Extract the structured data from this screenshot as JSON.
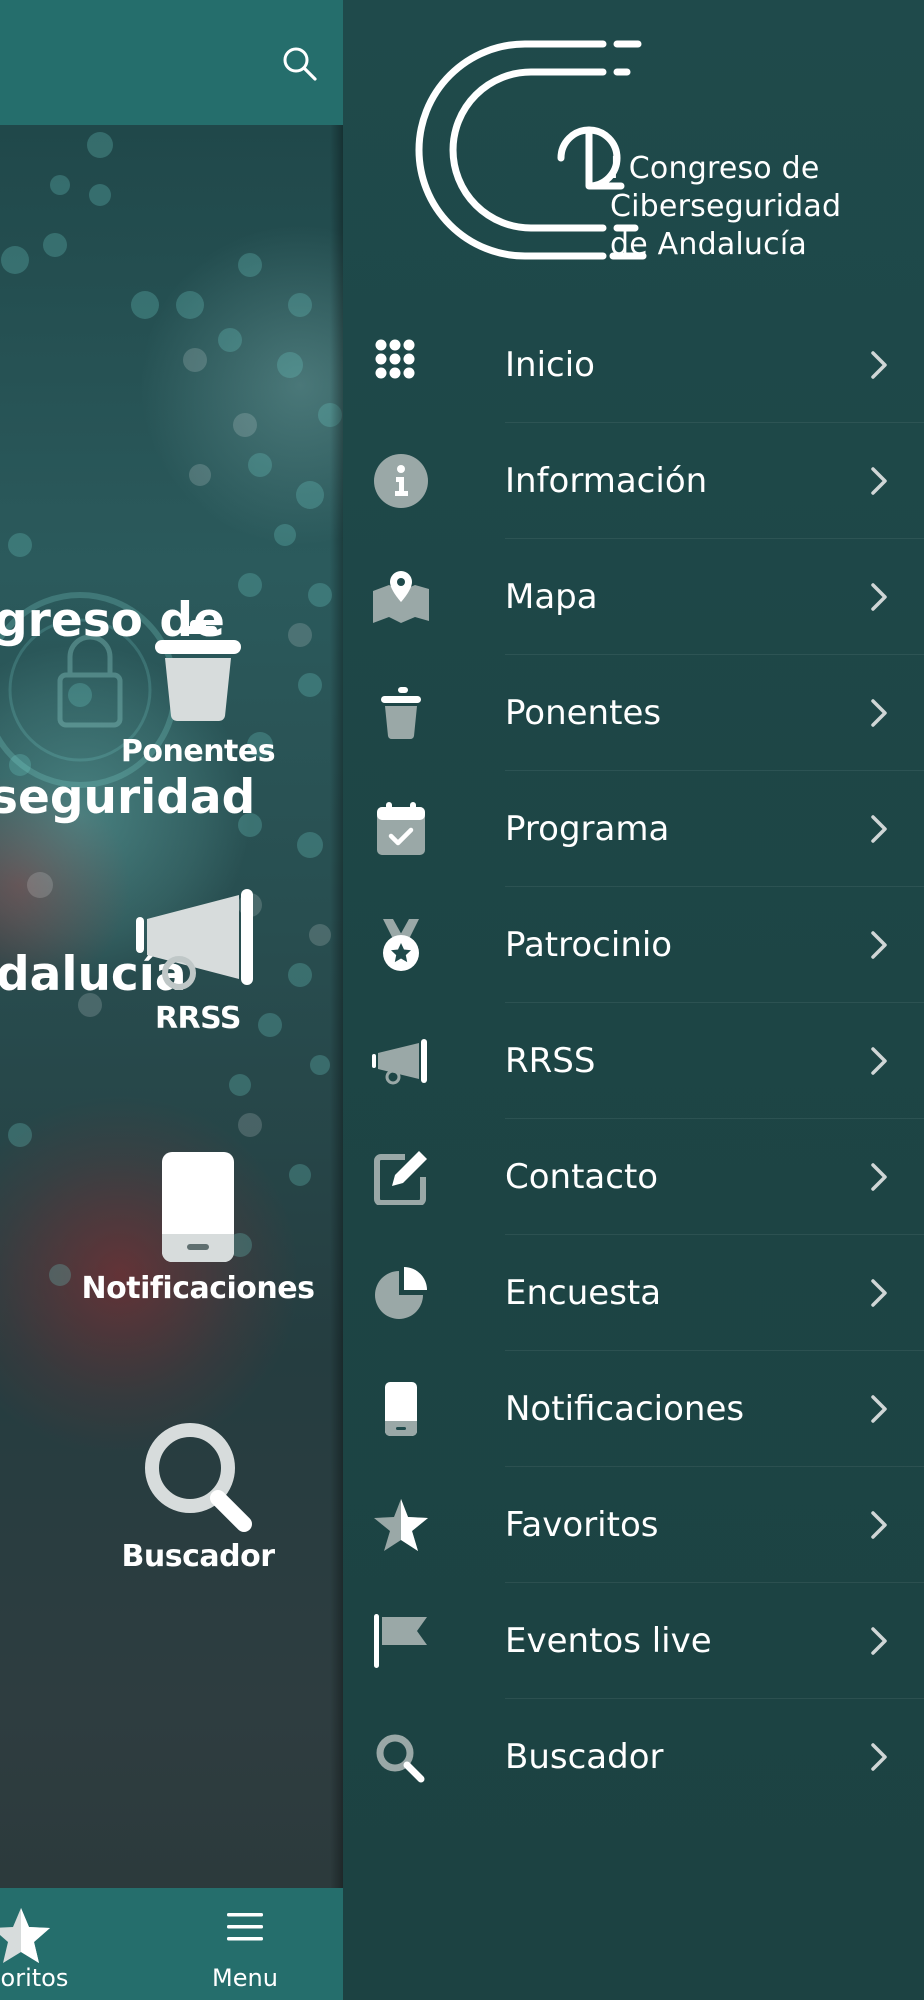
{
  "left": {
    "hero_title": {
      "line1": "greso de",
      "line2": "seguridad",
      "line3": "dalucía"
    },
    "grid": [
      {
        "label": "Ponentes",
        "icon": "trash-can-icon"
      },
      {
        "label": "RRSS",
        "icon": "megaphone-icon"
      },
      {
        "label": "Notificaciones",
        "icon": "mobile-phone-icon"
      },
      {
        "label": "Buscador",
        "icon": "search-icon"
      }
    ],
    "tabbar": {
      "favorites_label": "avoritos",
      "menu_label": "Menu"
    }
  },
  "drawer": {
    "logo_text": "I Congreso de\nCiberseguridad\nde Andalucía",
    "items": [
      {
        "label": "Inicio",
        "icon": "grid-dots-icon"
      },
      {
        "label": "Información",
        "icon": "info-icon"
      },
      {
        "label": "Mapa",
        "icon": "map-pin-icon"
      },
      {
        "label": "Ponentes",
        "icon": "trash-can-icon"
      },
      {
        "label": "Programa",
        "icon": "calendar-check-icon"
      },
      {
        "label": "Patrocinio",
        "icon": "medal-icon"
      },
      {
        "label": "RRSS",
        "icon": "megaphone-icon"
      },
      {
        "label": "Contacto",
        "icon": "edit-icon"
      },
      {
        "label": "Encuesta",
        "icon": "pie-chart-icon"
      },
      {
        "label": "Notificaciones",
        "icon": "mobile-phone-icon"
      },
      {
        "label": "Favoritos",
        "icon": "star-icon"
      },
      {
        "label": "Eventos live",
        "icon": "flag-icon"
      },
      {
        "label": "Buscador",
        "icon": "search-icon"
      }
    ]
  },
  "colors": {
    "header_teal": "#256e6c",
    "drawer_bg": "#1f4a4b",
    "icon_gray": "#9aa8a7",
    "text": "#ffffff"
  }
}
